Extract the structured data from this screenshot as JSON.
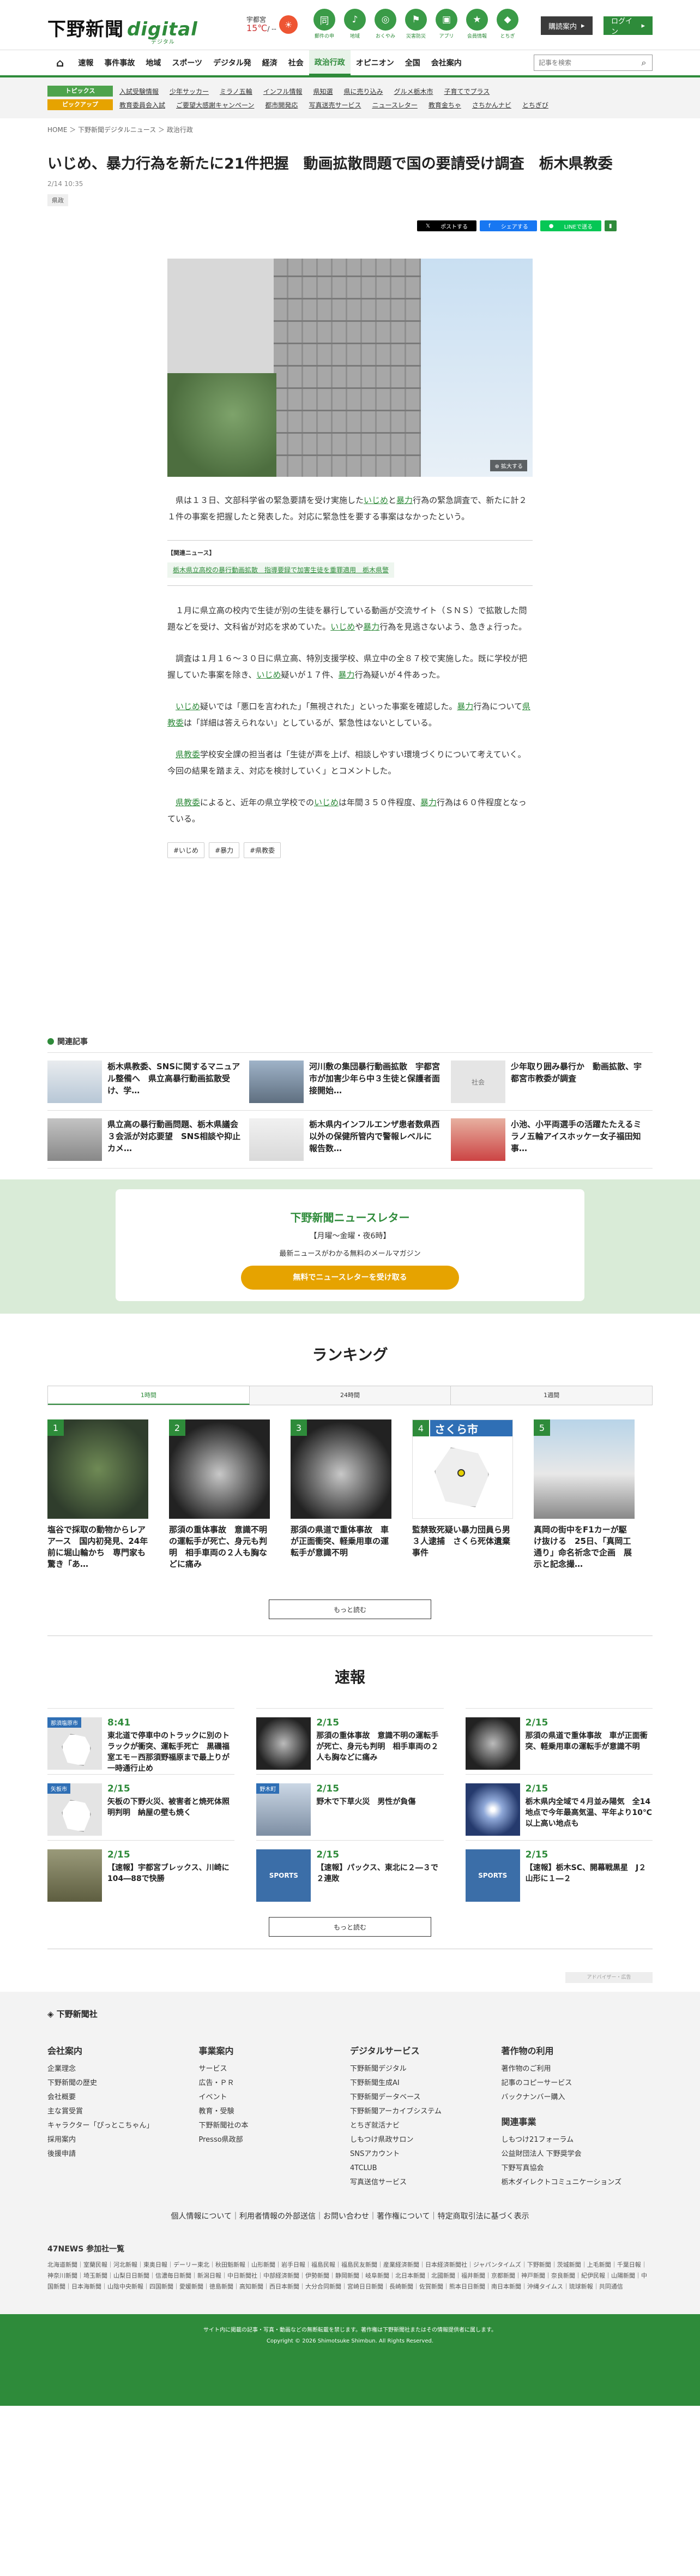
{
  "header": {
    "logo_main": "下野新聞",
    "logo_sub": "digital",
    "logo_tag": "デジタル",
    "weather_area": "宇都宮",
    "weather_temp": "15℃",
    "weather_min": "/ --",
    "weather_icon": "sun-icon",
    "quick": [
      {
        "icon": "同",
        "label": "郵件の申"
      },
      {
        "icon": "♪",
        "label": "地域"
      },
      {
        "icon": "◎",
        "label": "おくやみ"
      },
      {
        "icon": "⚑",
        "label": "災害防災"
      },
      {
        "icon": "▣",
        "label": "アプリ"
      },
      {
        "icon": "★",
        "label": "会員情報"
      },
      {
        "icon": "◆",
        "label": "とちぎ"
      }
    ],
    "subscribe_label": "購読案内",
    "login_label": "ログイン"
  },
  "nav": {
    "items": [
      "速報",
      "事件事故",
      "地域",
      "スポーツ",
      "デジタル発",
      "経済",
      "社会",
      "政治行政",
      "オピニオン",
      "全国",
      "会社案内"
    ],
    "active": "政治行政",
    "search_placeholder": "記事を検索"
  },
  "topics": {
    "label1": "トピックス",
    "items1": [
      "入試受験情報",
      "少年サッカー",
      "ミラノ五輪",
      "インフル情報",
      "県知選",
      "県に売り込み",
      "グルメ栃木市",
      "子育てでプラス"
    ],
    "label2": "ピックアップ",
    "items2": [
      "教育委員会入試",
      "ご要望大感謝キャンペーン",
      "都市開発応",
      "写真送売サービス",
      "ニュースレター",
      "教育金ちゃ",
      "さちかんナビ",
      "とちぎび"
    ]
  },
  "breadcrumb": [
    "HOME",
    "下野新聞デジタルニュース",
    "政治行政"
  ],
  "article": {
    "title": "いじめ、暴力行為を新たに21件把握　動画拡散問題で国の要請受け調査　栃木県教委",
    "date": "2/14 10:35",
    "category": "県政",
    "share": {
      "x": "ポストする",
      "fb": "シェアする",
      "line": "LINEで送る"
    },
    "photo_zoom": "拡大する",
    "p1": "県は１３日、文部科学省の緊急要請を受け実施したいじめと暴力行為の緊急調査で、新たに計２１件の事案を把握したと発表した。対応に緊急性を要する事案はなかったという。",
    "related_label": "【関連ニュース】",
    "related_link": "栃木県立高校の暴行動画拡散　指導要録で加害生徒を重罪適用　栃木県警",
    "p2": "１月に県立高の校内で生徒が別の生徒を暴行している動画が交流サイト（ＳＮＳ）で拡散した問題などを受け、文科省が対応を求めていた。いじめや暴力行為を見逃さないよう、急きょ行った。",
    "p3": "調査は１月１６～３０日に県立高、特別支援学校、県立中の全８７校で実施した。既に学校が把握していた事案を除き、いじめ疑いが１７件、暴力行為疑いが４件あった。",
    "p4": "いじめ疑いでは「悪口を言われた」「無視された」といった事案を確認した。暴力行為について県教委は「詳細は答えられない」としているが、緊急性はないとしている。",
    "p5": "県教委学校安全課の担当者は「生徒が声を上げ、相談しやすい環境づくりについて考えていく。今回の結果を踏まえ、対応を検討していく」とコメントした。",
    "p6": "県教委によると、近年の県立学校でのいじめは年間３５０件程度、暴力行為は６０件程度となっている。",
    "tags": [
      "#いじめ",
      "#暴力",
      "#県教委"
    ]
  },
  "related": {
    "heading": "関連記事",
    "items": [
      "栃木県教委、SNSに関するマニュアル整備へ　県立高暴行動画拡散受け、学…",
      "河川敷の集団暴行動画拡散　宇都宮市が加害少年ら中３生徒と保護者面接開始…",
      "少年取り囲み暴行か　動画拡散、宇都宮市教委が調査",
      "県立高の暴行動画問題、栃木県議会３会派が対応要望　SNS相談や抑止カメ…",
      "栃木県内インフルエンザ患者数県西以外の保健所管内で警報レベルに　報告数…",
      "小池、小平両選手の活躍たたえるミラノ五輪アイスホッケー女子福田知事…"
    ],
    "thumb_label_3": "社会"
  },
  "newsletter": {
    "title": "下野新聞ニュースレター",
    "schedule": "【月曜～金曜・夜6時】",
    "desc": "最新ニュースがわかる無料のメールマガジン",
    "button": "無料でニュースレターを受け取る"
  },
  "ranking": {
    "heading": "ランキング",
    "tabs": [
      "1時間",
      "24時間",
      "1週間"
    ],
    "items": [
      {
        "rank": "1",
        "title": "塩谷で採取の動物からレアアース　国内初発見、24年前に堀山輪かち　専門家も驚き「あ…"
      },
      {
        "rank": "2",
        "title": "那須の重体事故　意識不明の運転手が死亡、身元も判明　相手車両の２人も胸などに痛み"
      },
      {
        "rank": "3",
        "title": "那須の県道で重体事故　車が正面衝突、軽乗用車の運転手が意識不明"
      },
      {
        "rank": "4",
        "title": "監禁致死疑い暴力団員ら男３人逮捕　さくら死体遺棄事件",
        "img_label": "さくら市"
      },
      {
        "rank": "5",
        "title": "真岡の街中をF1カーが駆け抜ける　25日、「真岡工通り」命名祈念で企画　展示と記念撮…"
      }
    ],
    "more": "もっと読む"
  },
  "sokuhou": {
    "heading": "速報",
    "items": [
      {
        "date": "8:41",
        "title": "東北道で停車中のトラックに別のトラックが衝突、運転手死亡　黒磯福室エモ－西那須野福原まで最上りが一時通行止め",
        "label": "那須塩原市"
      },
      {
        "date": "2/15",
        "title": "那須の重体事故　意識不明の運転手が死亡、身元も判明　相手車両の２人も胸などに痛み",
        "label": ""
      },
      {
        "date": "2/15",
        "title": "那須の県道で重体事故　車が正面衝突、軽乗用車の運転手が意識不明",
        "label": ""
      },
      {
        "date": "2/15",
        "title": "矢板の下野火災、被害者と焼死体照明判明　納屋の壁も焼く",
        "label": "矢板市"
      },
      {
        "date": "2/15",
        "title": "野木で下草火災　男性が負傷",
        "label": "野木町"
      },
      {
        "date": "2/15",
        "title": "栃木県内全域で４月並み陽気　全14地点で今年最高気温、平年より10℃以上高い地点も",
        "label": ""
      },
      {
        "date": "2/15",
        "title": "【速報】宇都宮ブレックス、川崎に104―88で快勝",
        "label": ""
      },
      {
        "date": "2/15",
        "title": "【速報】パックス、東北に２―３で２連敗",
        "label": "",
        "img": "SPORTS"
      },
      {
        "date": "2/15",
        "title": "【速報】栃木SC、開幕戦黒星　J２山形に１―２",
        "label": "",
        "img": "SPORTS"
      }
    ],
    "more": "もっと読む",
    "ad_label": "アドバイザー・広告"
  },
  "footer": {
    "logo": "下野新聞社",
    "cols": [
      {
        "title": "会社案内",
        "links": [
          "企業理念",
          "下野新聞の歴史",
          "会社概要",
          "主な賞受賞",
          "キャラクター「ぴっとこちゃん」",
          "採用案内",
          "後援申請"
        ]
      },
      {
        "title": "事業案内",
        "links": [
          "サービス",
          "広告・ＰＲ",
          "イベント",
          "教育・受験",
          "下野新聞社の本",
          "Presso県政部"
        ]
      },
      {
        "title": "デジタルサービス",
        "links": [
          "下野新聞デジタル",
          "下野新聞生成AI",
          "下野新聞データベース",
          "下野新聞アーカイブシステム",
          "とちぎ就活ナビ",
          "しもつけ県政サロン",
          "SNSアカウント",
          "4TCLUB",
          "写真送信サービス"
        ]
      },
      {
        "title": "著作物の利用",
        "links": [
          "著作物のご利用",
          "記事のコピーサービス",
          "バックナンバー購入"
        ],
        "title2": "関連事業",
        "links2": [
          "しもつけ21フォーラム",
          "公益財団法人 下野奨学会",
          "下野写真協会",
          "栃木ダイレクトコミュニケーションズ"
        ]
      }
    ],
    "bottom_links": "個人情報について｜利用者情報の外部送信｜お問い合わせ｜著作権について｜特定商取引法に基づく表示",
    "news_heading": "47NEWS 参加社一覧",
    "news_list": "北海道新聞｜室蘭民報｜河北新報｜東奥日報｜デーリー東北｜秋田魁新報｜山形新聞｜岩手日報｜福島民報｜福島民友新聞｜産業経済新聞｜日本経済新聞社｜ジャパンタイムズ｜下野新聞｜茨城新聞｜上毛新聞｜千葉日報｜神奈川新聞｜埼玉新聞｜山梨日日新聞｜信濃毎日新聞｜新潟日報｜中日新聞社｜中部経済新聞｜伊勢新聞｜静岡新聞｜岐阜新聞｜北日本新聞｜北國新聞｜福井新聞｜京都新聞｜神戸新聞｜奈良新聞｜紀伊民報｜山陽新聞｜中国新聞｜日本海新聞｜山陰中央新報｜四国新聞｜愛媛新聞｜徳島新聞｜高知新聞｜西日本新聞｜大分合同新聞｜宮崎日日新聞｜長崎新聞｜佐賀新聞｜熊本日日新聞｜南日本新聞｜沖縄タイムス｜琉球新報｜共同通信",
    "copy1": "サイト内に掲載の記事・写真・動画などの無断転載を禁じます。著作権は下野新聞社またはその情報提供者に属します。",
    "copy2": "Copyright © 2026 Shimotsuke Shimbun. All Rights Reserved."
  },
  "colors": {
    "brand_green": "#2e8b3a",
    "accent_orange": "#e6a300",
    "label_blue": "#2f6fb5"
  }
}
